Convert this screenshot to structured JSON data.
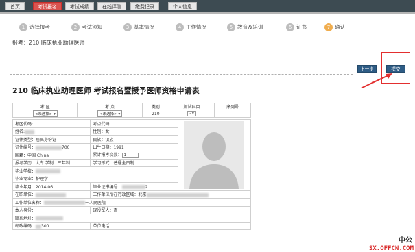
{
  "nav": {
    "tabs": [
      {
        "label": "首页"
      },
      {
        "label": "考试报名",
        "active": true
      },
      {
        "label": "考试成绩"
      },
      {
        "label": "在线评测"
      },
      {
        "label": "缴费记录"
      },
      {
        "label": "个人信息"
      }
    ]
  },
  "steps": [
    {
      "num": "1",
      "label": "选择报考"
    },
    {
      "num": "2",
      "label": "考试须知"
    },
    {
      "num": "3",
      "label": "基本情况"
    },
    {
      "num": "4",
      "label": "工作情况"
    },
    {
      "num": "5",
      "label": "教育及培训"
    },
    {
      "num": "6",
      "label": "证书"
    },
    {
      "num": "7",
      "label": "确认",
      "active": true
    }
  ],
  "subtitle": "报考：210 临床执业助理医师",
  "buttons": {
    "prev": "上一步",
    "submit": "提交"
  },
  "title": "210 临床执业助理医师 考试报名暨授予医师资格申请表",
  "header_table": {
    "columns": [
      "考 区",
      "考 点",
      "类别",
      "加试科目",
      "序列号"
    ],
    "values": [
      "<未选择>",
      "<未选择>",
      "210",
      "-",
      ""
    ]
  },
  "form": {
    "exam_area_code": "考区代码:",
    "exam_site_code": "考点代码:",
    "name_label": "姓名:",
    "gender": "性别：女",
    "id_type": "证件类型：居民身份证",
    "ethnicity": "民族：汉族",
    "id_number_label": "证件编号：",
    "id_number_tail": "700",
    "birth_label": "出生日期：1991",
    "nationality": "国籍：中国 China",
    "exam_count_label": "累计报考次数：",
    "exam_count": "1",
    "degree": "报考学历：大专   学制：三年制",
    "study_form": "学习形式：普通全日制",
    "school_label": "毕业学校：",
    "major": "毕业专业：护理学",
    "grad_date": "毕业年月：2014-06",
    "cert_no_label": "毕业证书编号：",
    "cert_no_tail": "2",
    "unit_label": "在职单位：",
    "unit_code_label": "工作单位所在行政区域：北京",
    "unit_name_label": "工作单位名称：",
    "unit_name_tail": "一人民医院",
    "identity_label": "本人身份：",
    "active_duty": "现役军人：否",
    "address_label": "联系地址：",
    "postcode_label": "邮政编码：",
    "postcode_tail": "300",
    "unit_phone_label": "单位电话："
  },
  "watermark": "SX.OFFCN.COM",
  "logo_text": "中公"
}
